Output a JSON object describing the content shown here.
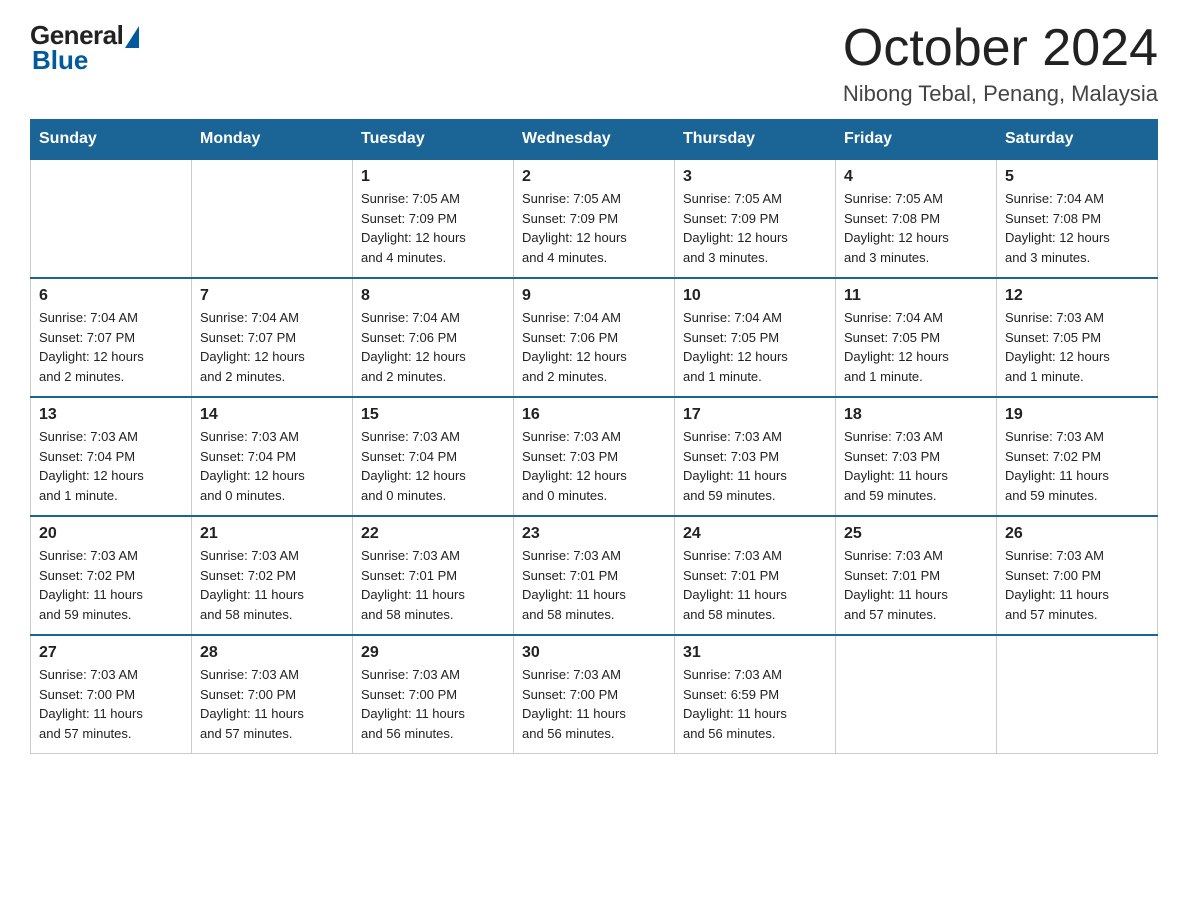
{
  "logo": {
    "general": "General",
    "blue": "Blue"
  },
  "title": "October 2024",
  "subtitle": "Nibong Tebal, Penang, Malaysia",
  "days_of_week": [
    "Sunday",
    "Monday",
    "Tuesday",
    "Wednesday",
    "Thursday",
    "Friday",
    "Saturday"
  ],
  "weeks": [
    [
      {
        "day": "",
        "info": ""
      },
      {
        "day": "",
        "info": ""
      },
      {
        "day": "1",
        "info": "Sunrise: 7:05 AM\nSunset: 7:09 PM\nDaylight: 12 hours\nand 4 minutes."
      },
      {
        "day": "2",
        "info": "Sunrise: 7:05 AM\nSunset: 7:09 PM\nDaylight: 12 hours\nand 4 minutes."
      },
      {
        "day": "3",
        "info": "Sunrise: 7:05 AM\nSunset: 7:09 PM\nDaylight: 12 hours\nand 3 minutes."
      },
      {
        "day": "4",
        "info": "Sunrise: 7:05 AM\nSunset: 7:08 PM\nDaylight: 12 hours\nand 3 minutes."
      },
      {
        "day": "5",
        "info": "Sunrise: 7:04 AM\nSunset: 7:08 PM\nDaylight: 12 hours\nand 3 minutes."
      }
    ],
    [
      {
        "day": "6",
        "info": "Sunrise: 7:04 AM\nSunset: 7:07 PM\nDaylight: 12 hours\nand 2 minutes."
      },
      {
        "day": "7",
        "info": "Sunrise: 7:04 AM\nSunset: 7:07 PM\nDaylight: 12 hours\nand 2 minutes."
      },
      {
        "day": "8",
        "info": "Sunrise: 7:04 AM\nSunset: 7:06 PM\nDaylight: 12 hours\nand 2 minutes."
      },
      {
        "day": "9",
        "info": "Sunrise: 7:04 AM\nSunset: 7:06 PM\nDaylight: 12 hours\nand 2 minutes."
      },
      {
        "day": "10",
        "info": "Sunrise: 7:04 AM\nSunset: 7:05 PM\nDaylight: 12 hours\nand 1 minute."
      },
      {
        "day": "11",
        "info": "Sunrise: 7:04 AM\nSunset: 7:05 PM\nDaylight: 12 hours\nand 1 minute."
      },
      {
        "day": "12",
        "info": "Sunrise: 7:03 AM\nSunset: 7:05 PM\nDaylight: 12 hours\nand 1 minute."
      }
    ],
    [
      {
        "day": "13",
        "info": "Sunrise: 7:03 AM\nSunset: 7:04 PM\nDaylight: 12 hours\nand 1 minute."
      },
      {
        "day": "14",
        "info": "Sunrise: 7:03 AM\nSunset: 7:04 PM\nDaylight: 12 hours\nand 0 minutes."
      },
      {
        "day": "15",
        "info": "Sunrise: 7:03 AM\nSunset: 7:04 PM\nDaylight: 12 hours\nand 0 minutes."
      },
      {
        "day": "16",
        "info": "Sunrise: 7:03 AM\nSunset: 7:03 PM\nDaylight: 12 hours\nand 0 minutes."
      },
      {
        "day": "17",
        "info": "Sunrise: 7:03 AM\nSunset: 7:03 PM\nDaylight: 11 hours\nand 59 minutes."
      },
      {
        "day": "18",
        "info": "Sunrise: 7:03 AM\nSunset: 7:03 PM\nDaylight: 11 hours\nand 59 minutes."
      },
      {
        "day": "19",
        "info": "Sunrise: 7:03 AM\nSunset: 7:02 PM\nDaylight: 11 hours\nand 59 minutes."
      }
    ],
    [
      {
        "day": "20",
        "info": "Sunrise: 7:03 AM\nSunset: 7:02 PM\nDaylight: 11 hours\nand 59 minutes."
      },
      {
        "day": "21",
        "info": "Sunrise: 7:03 AM\nSunset: 7:02 PM\nDaylight: 11 hours\nand 58 minutes."
      },
      {
        "day": "22",
        "info": "Sunrise: 7:03 AM\nSunset: 7:01 PM\nDaylight: 11 hours\nand 58 minutes."
      },
      {
        "day": "23",
        "info": "Sunrise: 7:03 AM\nSunset: 7:01 PM\nDaylight: 11 hours\nand 58 minutes."
      },
      {
        "day": "24",
        "info": "Sunrise: 7:03 AM\nSunset: 7:01 PM\nDaylight: 11 hours\nand 58 minutes."
      },
      {
        "day": "25",
        "info": "Sunrise: 7:03 AM\nSunset: 7:01 PM\nDaylight: 11 hours\nand 57 minutes."
      },
      {
        "day": "26",
        "info": "Sunrise: 7:03 AM\nSunset: 7:00 PM\nDaylight: 11 hours\nand 57 minutes."
      }
    ],
    [
      {
        "day": "27",
        "info": "Sunrise: 7:03 AM\nSunset: 7:00 PM\nDaylight: 11 hours\nand 57 minutes."
      },
      {
        "day": "28",
        "info": "Sunrise: 7:03 AM\nSunset: 7:00 PM\nDaylight: 11 hours\nand 57 minutes."
      },
      {
        "day": "29",
        "info": "Sunrise: 7:03 AM\nSunset: 7:00 PM\nDaylight: 11 hours\nand 56 minutes."
      },
      {
        "day": "30",
        "info": "Sunrise: 7:03 AM\nSunset: 7:00 PM\nDaylight: 11 hours\nand 56 minutes."
      },
      {
        "day": "31",
        "info": "Sunrise: 7:03 AM\nSunset: 6:59 PM\nDaylight: 11 hours\nand 56 minutes."
      },
      {
        "day": "",
        "info": ""
      },
      {
        "day": "",
        "info": ""
      }
    ]
  ]
}
